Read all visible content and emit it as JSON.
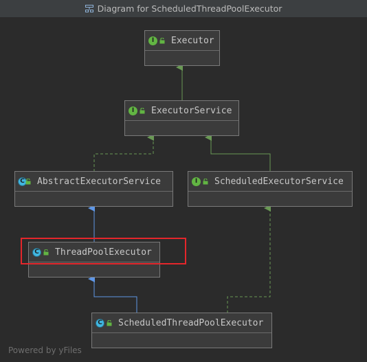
{
  "window": {
    "title": "Diagram for ScheduledThreadPoolExecutor",
    "title_icon": "diagram-icon"
  },
  "nodes": {
    "executor": {
      "name": "Executor",
      "kind": "interface",
      "kind_letter": "I"
    },
    "executor_service": {
      "name": "ExecutorService",
      "kind": "interface",
      "kind_letter": "I"
    },
    "abstract_executor_service": {
      "name": "AbstractExecutorService",
      "kind": "abstract class",
      "kind_letter": "C"
    },
    "scheduled_executor_service": {
      "name": "ScheduledExecutorService",
      "kind": "interface",
      "kind_letter": "I"
    },
    "thread_pool_executor": {
      "name": "ThreadPoolExecutor",
      "kind": "class",
      "kind_letter": "C"
    },
    "scheduled_thread_pool_executor": {
      "name": "ScheduledThreadPoolExecutor",
      "kind": "class",
      "kind_letter": "C"
    }
  },
  "relations": [
    {
      "from": "ExecutorService",
      "to": "Executor",
      "type": "extends-interface",
      "color": "#6a9955",
      "style": "solid"
    },
    {
      "from": "AbstractExecutorService",
      "to": "ExecutorService",
      "type": "implements",
      "color": "#6a9955",
      "style": "dashed"
    },
    {
      "from": "ScheduledExecutorService",
      "to": "ExecutorService",
      "type": "extends-interface",
      "color": "#6a9955",
      "style": "solid"
    },
    {
      "from": "ThreadPoolExecutor",
      "to": "AbstractExecutorService",
      "type": "extends",
      "color": "#5f97e6",
      "style": "solid"
    },
    {
      "from": "ScheduledThreadPoolExecutor",
      "to": "ThreadPoolExecutor",
      "type": "extends",
      "color": "#5f97e6",
      "style": "solid"
    },
    {
      "from": "ScheduledThreadPoolExecutor",
      "to": "ScheduledExecutorService",
      "type": "implements",
      "color": "#6a9955",
      "style": "dashed"
    }
  ],
  "highlight": {
    "target": "ThreadPoolExecutor",
    "color": "#e5262b"
  },
  "colors": {
    "interface_badge": "#62b543",
    "class_badge": "#40b6e0",
    "implements_arrow": "#6a9955",
    "extends_arrow": "#5f97e6",
    "background": "#2b2b2b",
    "node_fill": "#3b3b3b"
  },
  "footer": {
    "text": "Powered by yFiles"
  }
}
